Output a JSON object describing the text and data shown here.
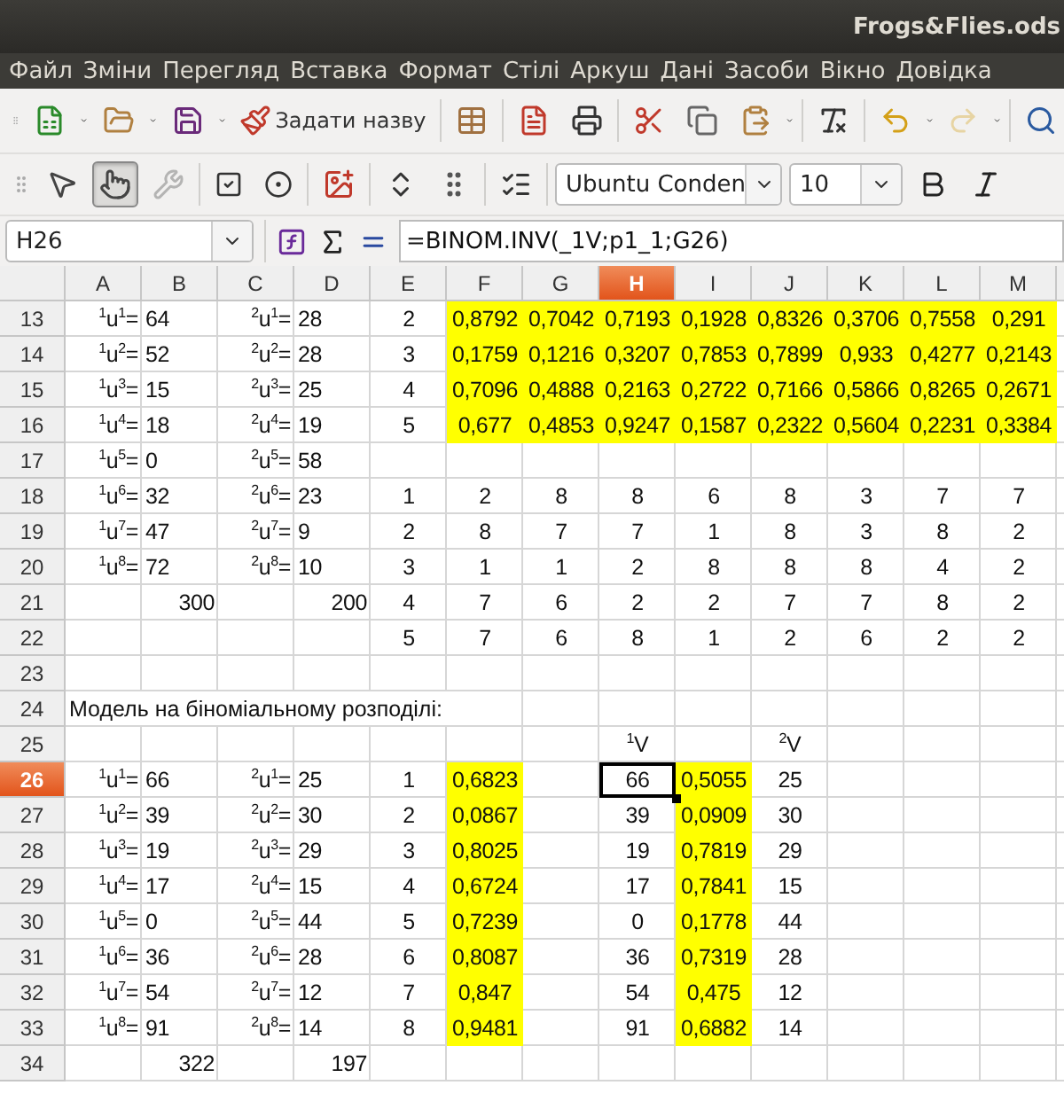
{
  "window": {
    "title": "Frogs&Flies.ods"
  },
  "menu": [
    "Файл",
    "Зміни",
    "Перегляд",
    "Вставка",
    "Формат",
    "Стілі",
    "Аркуш",
    "Дані",
    "Засоби",
    "Вікно",
    "Довідка"
  ],
  "toolbar_1": {
    "name_button": "Задати назву",
    "redo_disabled": true
  },
  "toolbar_2": {
    "button_tool_selected": true,
    "design_mode_disabled": true,
    "font_name": "Ubuntu Conden",
    "font_size": "10"
  },
  "formula_bar": {
    "name_box": "H26",
    "formula": "=BINOM.INV(_1V;p1_1;G26)"
  },
  "columns": [
    {
      "label": "A",
      "selected": false
    },
    {
      "label": "B",
      "selected": false
    },
    {
      "label": "C",
      "selected": false
    },
    {
      "label": "D",
      "selected": false
    },
    {
      "label": "E",
      "selected": false
    },
    {
      "label": "F",
      "selected": false
    },
    {
      "label": "G",
      "selected": false
    },
    {
      "label": "H",
      "selected": true
    },
    {
      "label": "I",
      "selected": false
    },
    {
      "label": "J",
      "selected": false
    },
    {
      "label": "K",
      "selected": false
    },
    {
      "label": "L",
      "selected": false
    },
    {
      "label": "M",
      "selected": false
    }
  ],
  "rows": [
    {
      "label": "13",
      "selected": false,
      "kind": "data",
      "cells": {
        "A": "$^{1}$u$^{1}$=",
        "B": "64",
        "C": "$^{2}$u$^{1}$=",
        "D": "28",
        "E": "2",
        "F": "0,8792",
        "G": "0,7042",
        "H": "0,7193",
        "I": "0,1928",
        "J": "0,8326",
        "K": "0,3706",
        "L": "0,7558",
        "M": "0,291"
      },
      "highlighted": {
        "F": true,
        "G": true,
        "H": true,
        "I": true,
        "J": true,
        "K": true,
        "L": true,
        "M": true
      }
    },
    {
      "label": "14",
      "selected": false,
      "kind": "data",
      "cells": {
        "A": "$^{1}$u$^{2}$=",
        "B": "52",
        "C": "$^{2}$u$^{2}$=",
        "D": "28",
        "E": "3",
        "F": "0,1759",
        "G": "0,1216",
        "H": "0,3207",
        "I": "0,7853",
        "J": "0,7899",
        "K": "0,933",
        "L": "0,4277",
        "M": "0,2143"
      },
      "highlighted": {
        "F": true,
        "G": true,
        "H": true,
        "I": true,
        "J": true,
        "K": true,
        "L": true,
        "M": true
      }
    },
    {
      "label": "15",
      "selected": false,
      "kind": "data",
      "cells": {
        "A": "$^{1}$u$^{3}$=",
        "B": "15",
        "C": "$^{2}$u$^{3}$=",
        "D": "25",
        "E": "4",
        "F": "0,7096",
        "G": "0,4888",
        "H": "0,2163",
        "I": "0,2722",
        "J": "0,7166",
        "K": "0,5866",
        "L": "0,8265",
        "M": "0,2671"
      },
      "highlighted": {
        "F": true,
        "G": true,
        "H": true,
        "I": true,
        "J": true,
        "K": true,
        "L": true,
        "M": true
      }
    },
    {
      "label": "16",
      "selected": false,
      "kind": "data",
      "cells": {
        "A": "$^{1}$u$^{4}$=",
        "B": "18",
        "C": "$^{2}$u$^{4}$=",
        "D": "19",
        "E": "5",
        "F": "0,677",
        "G": "0,4853",
        "H": "0,9247",
        "I": "0,1587",
        "J": "0,2322",
        "K": "0,5604",
        "L": "0,2231",
        "M": "0,3384"
      },
      "highlighted": {
        "F": true,
        "G": true,
        "H": true,
        "I": true,
        "J": true,
        "K": true,
        "L": true,
        "M": true
      }
    },
    {
      "label": "17",
      "selected": false,
      "kind": "data",
      "cells": {
        "A": "$^{1}$u$^{5}$=",
        "B": "0",
        "C": "$^{2}$u$^{5}$=",
        "D": "58"
      }
    },
    {
      "label": "18",
      "selected": false,
      "kind": "data",
      "cells": {
        "A": "$^{1}$u$^{6}$=",
        "B": "32",
        "C": "$^{2}$u$^{6}$=",
        "D": "23",
        "E": "1",
        "F": "2",
        "G": "8",
        "H": "8",
        "I": "6",
        "J": "8",
        "K": "3",
        "L": "7",
        "M": "7"
      }
    },
    {
      "label": "19",
      "selected": false,
      "kind": "data",
      "cells": {
        "A": "$^{1}$u$^{7}$=",
        "B": "47",
        "C": "$^{2}$u$^{7}$=",
        "D": "9",
        "E": "2",
        "F": "8",
        "G": "7",
        "H": "7",
        "I": "1",
        "J": "8",
        "K": "3",
        "L": "8",
        "M": "2"
      }
    },
    {
      "label": "20",
      "selected": false,
      "kind": "data",
      "cells": {
        "A": "$^{1}$u$^{8}$=",
        "B": "72",
        "C": "$^{2}$u$^{8}$=",
        "D": "10",
        "E": "3",
        "F": "1",
        "G": "1",
        "H": "2",
        "I": "8",
        "J": "8",
        "K": "8",
        "L": "4",
        "M": "2"
      }
    },
    {
      "label": "21",
      "selected": false,
      "kind": "data",
      "cells": {
        "B": "300",
        "D": "200",
        "E": "4",
        "F": "7",
        "G": "6",
        "H": "2",
        "I": "2",
        "J": "7",
        "K": "7",
        "L": "8",
        "M": "2"
      }
    },
    {
      "label": "22",
      "selected": false,
      "kind": "data",
      "cells": {
        "E": "5",
        "F": "7",
        "G": "6",
        "H": "8",
        "I": "1",
        "J": "2",
        "K": "6",
        "L": "2",
        "M": "2"
      }
    },
    {
      "label": "23",
      "selected": false,
      "kind": "data",
      "cells": {}
    },
    {
      "label": "24",
      "selected": false,
      "kind": "heading",
      "text": "Модель на біноміальному розподілі:"
    },
    {
      "label": "25",
      "selected": false,
      "kind": "data",
      "cells": {
        "H": "$^{1}$V",
        "J": "$^{2}$V"
      }
    },
    {
      "label": "26",
      "selected": true,
      "kind": "data",
      "cells": {
        "A": "$^{1}$u$^{1}$=",
        "B": "66",
        "C": "$^{2}$u$^{1}$=",
        "D": "25",
        "E": "1",
        "F": "0,6823",
        "H": "66",
        "I": "0,5055",
        "J": "25"
      },
      "highlighted": {
        "F": true,
        "I": true
      }
    },
    {
      "label": "27",
      "selected": false,
      "kind": "data",
      "cells": {
        "A": "$^{1}$u$^{2}$=",
        "B": "39",
        "C": "$^{2}$u$^{2}$=",
        "D": "30",
        "E": "2",
        "F": "0,0867",
        "H": "39",
        "I": "0,0909",
        "J": "30"
      },
      "highlighted": {
        "F": true,
        "I": true
      }
    },
    {
      "label": "28",
      "selected": false,
      "kind": "data",
      "cells": {
        "A": "$^{1}$u$^{3}$=",
        "B": "19",
        "C": "$^{2}$u$^{3}$=",
        "D": "29",
        "E": "3",
        "F": "0,8025",
        "H": "19",
        "I": "0,7819",
        "J": "29"
      },
      "highlighted": {
        "F": true,
        "I": true
      }
    },
    {
      "label": "29",
      "selected": false,
      "kind": "data",
      "cells": {
        "A": "$^{1}$u$^{4}$=",
        "B": "17",
        "C": "$^{2}$u$^{4}$=",
        "D": "15",
        "E": "4",
        "F": "0,6724",
        "H": "17",
        "I": "0,7841",
        "J": "15"
      },
      "highlighted": {
        "F": true,
        "I": true
      }
    },
    {
      "label": "30",
      "selected": false,
      "kind": "data",
      "cells": {
        "A": "$^{1}$u$^{5}$=",
        "B": "0",
        "C": "$^{2}$u$^{5}$=",
        "D": "44",
        "E": "5",
        "F": "0,7239",
        "H": "0",
        "I": "0,1778",
        "J": "44"
      },
      "highlighted": {
        "F": true,
        "I": true
      }
    },
    {
      "label": "31",
      "selected": false,
      "kind": "data",
      "cells": {
        "A": "$^{1}$u$^{6}$=",
        "B": "36",
        "C": "$^{2}$u$^{6}$=",
        "D": "28",
        "E": "6",
        "F": "0,8087",
        "H": "36",
        "I": "0,7319",
        "J": "28"
      },
      "highlighted": {
        "F": true,
        "I": true
      }
    },
    {
      "label": "32",
      "selected": false,
      "kind": "data",
      "cells": {
        "A": "$^{1}$u$^{7}$=",
        "B": "54",
        "C": "$^{2}$u$^{7}$=",
        "D": "12",
        "E": "7",
        "F": "0,847",
        "H": "54",
        "I": "0,475",
        "J": "12"
      },
      "highlighted": {
        "F": true,
        "I": true
      }
    },
    {
      "label": "33",
      "selected": false,
      "kind": "data",
      "cells": {
        "A": "$^{1}$u$^{8}$=",
        "B": "91",
        "C": "$^{2}$u$^{8}$=",
        "D": "14",
        "E": "8",
        "F": "0,9481",
        "H": "91",
        "I": "0,6882",
        "J": "14"
      },
      "highlighted": {
        "F": true,
        "I": true
      }
    },
    {
      "label": "34",
      "selected": false,
      "kind": "data",
      "cells": {
        "B": "322",
        "D": "197"
      }
    }
  ]
}
